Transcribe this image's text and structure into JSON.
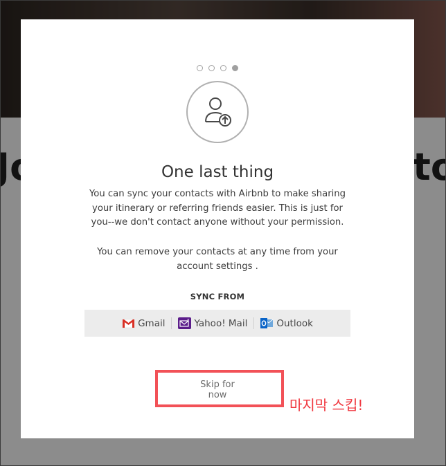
{
  "background": {
    "headline_left": "Jo",
    "headline_right": "to"
  },
  "modal": {
    "step_total": 4,
    "step_current": 4,
    "icon": "user-upload-icon",
    "title": "One last thing",
    "description": "You can sync your contacts with Airbnb to make sharing your itinerary or referring friends easier. This is just for you--we don't contact anyone without your permission.",
    "description2": "You can remove your contacts at any time from your account settings .",
    "sync_label": "SYNC FROM",
    "providers": [
      {
        "label": "Gmail",
        "icon": "gmail-icon"
      },
      {
        "label": "Yahoo! Mail",
        "icon": "yahoo-icon"
      },
      {
        "label": "Outlook",
        "icon": "outlook-icon"
      }
    ],
    "skip_label": "Skip for now"
  },
  "annotation": {
    "text": "마지막 스킵!",
    "color": "#f0363e"
  }
}
